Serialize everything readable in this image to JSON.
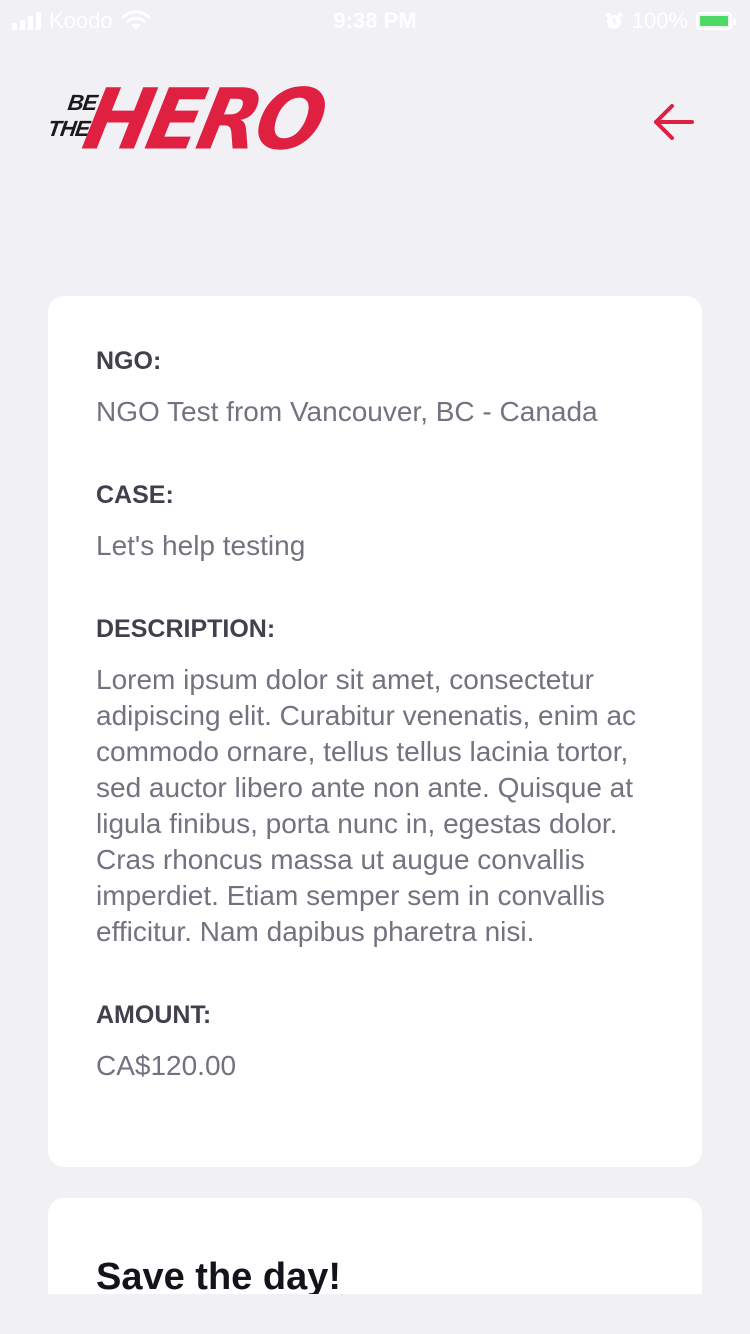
{
  "status_bar": {
    "carrier": "Koodo",
    "time": "9:38 PM",
    "battery": "100%",
    "battery_level": 1.0
  },
  "header": {
    "logo": {
      "text_small_1": "BE",
      "text_small_2": "THE",
      "text_large": "HERO"
    },
    "back_icon": "arrow-left-icon",
    "accent_color": "#e02041"
  },
  "incident": {
    "ngo_label": "NGO:",
    "ngo_value": "NGO Test from Vancouver, BC - Canada",
    "case_label": "CASE:",
    "case_value": "Let's help testing",
    "description_label": "DESCRIPTION:",
    "description_value": "Lorem ipsum dolor sit amet, consectetur adipiscing elit. Curabitur venenatis, enim ac commodo ornare, tellus tellus lacinia tortor, sed auctor libero ante non ante. Quisque at ligula finibus, porta nunc in, egestas dolor. Cras rhoncus massa ut augue convallis imperdiet. Etiam semper sem in convallis efficitur. Nam dapibus pharetra nisi.",
    "amount_label": "AMOUNT:",
    "amount_value": "CA$120.00"
  },
  "contact": {
    "title": "Save the day!"
  }
}
